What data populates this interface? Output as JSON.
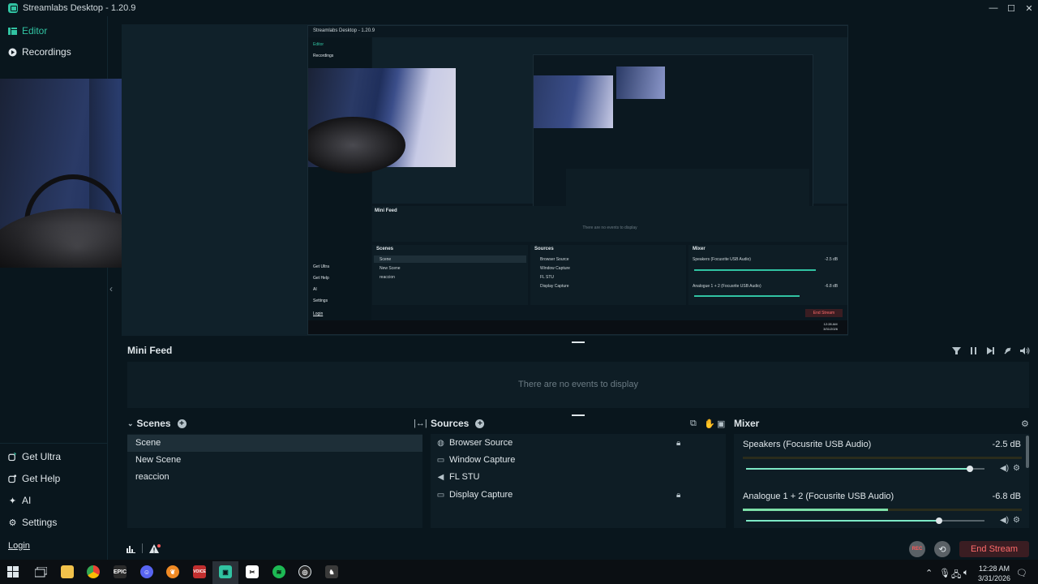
{
  "window": {
    "title": "Streamlabs Desktop - 1.20.9",
    "controls": [
      "—",
      "☐",
      "✕"
    ]
  },
  "sidebar": {
    "top_items": [
      {
        "label": "Editor",
        "icon": "editor-icon",
        "active": true
      },
      {
        "label": "Recordings",
        "icon": "recordings-icon"
      }
    ],
    "bottom_items": [
      {
        "label": "Get Ultra",
        "icon": "ultra-icon"
      },
      {
        "label": "Get Help",
        "icon": "help-icon"
      },
      {
        "label": "AI",
        "icon": "ai-sparkle-icon"
      },
      {
        "label": "Settings",
        "icon": "gear-icon"
      }
    ],
    "login": "Login"
  },
  "nested_preview": {
    "title": "Streamlabs Desktop - 1.20.9",
    "nav": [
      "Editor",
      "Recordings"
    ],
    "bottom_nav": [
      "Get Ultra",
      "Get Help",
      "AI",
      "Settings"
    ],
    "login": "Login",
    "mini_feed_title": "Mini Feed",
    "mini_feed_empty": "There are no events to display",
    "scenes_title": "Scenes",
    "scenes": [
      "Scene",
      "New Scene",
      "reaccion"
    ],
    "sources_title": "Sources",
    "sources": [
      "Browser Source",
      "Window Capture",
      "FL STU",
      "Display Capture"
    ],
    "mixer_title": "Mixer",
    "mixer": [
      {
        "name": "Speakers (Focusrite USB Audio)",
        "db": "-2.5 dB"
      },
      {
        "name": "Analogue 1 + 2 (Focusrite USB Audio)",
        "db": "-6.8 dB"
      }
    ],
    "end_stream": "End Stream",
    "clock_time": "12:28 AM",
    "clock_date": "3/31/2026"
  },
  "mini_feed": {
    "title": "Mini Feed",
    "empty_text": "There are no events to display"
  },
  "scenes": {
    "title": "Scenes",
    "items": [
      {
        "label": "Scene",
        "selected": true
      },
      {
        "label": "New Scene"
      },
      {
        "label": "reaccion"
      }
    ]
  },
  "sources": {
    "title": "Sources",
    "items": [
      {
        "label": "Browser Source",
        "icon": "globe-icon",
        "locked": true
      },
      {
        "label": "Window Capture",
        "icon": "window-icon",
        "locked": false
      },
      {
        "label": "FL STU",
        "icon": "speaker-icon",
        "locked": false
      },
      {
        "label": "Display Capture",
        "icon": "monitor-icon",
        "locked": true
      }
    ]
  },
  "mixer": {
    "title": "Mixer",
    "channels": [
      {
        "name": "Speakers (Focusrite USB Audio)",
        "db": "-2.5 dB",
        "volume": 0.94
      },
      {
        "name": "Analogue 1 + 2 (Focusrite USB Audio)",
        "db": "-6.8 dB",
        "volume": 0.81,
        "meter": 0.52
      }
    ]
  },
  "footer": {
    "rec_label": "REC",
    "end_stream_label": "End Stream"
  },
  "taskbar": {
    "apps": [
      "start",
      "task-view",
      "file-explorer",
      "chrome",
      "epic-games",
      "discord",
      "fl-studio",
      "voicemeeter",
      "streamlabs",
      "capcut",
      "spotify",
      "obs",
      "app-extra"
    ],
    "time": "12:28 AM",
    "date": "3/31/2026"
  },
  "colors": {
    "accent": "#31c3a2",
    "background": "#09161d",
    "panel": "#0e1d25",
    "end_stream_text": "#ff6b6b"
  }
}
